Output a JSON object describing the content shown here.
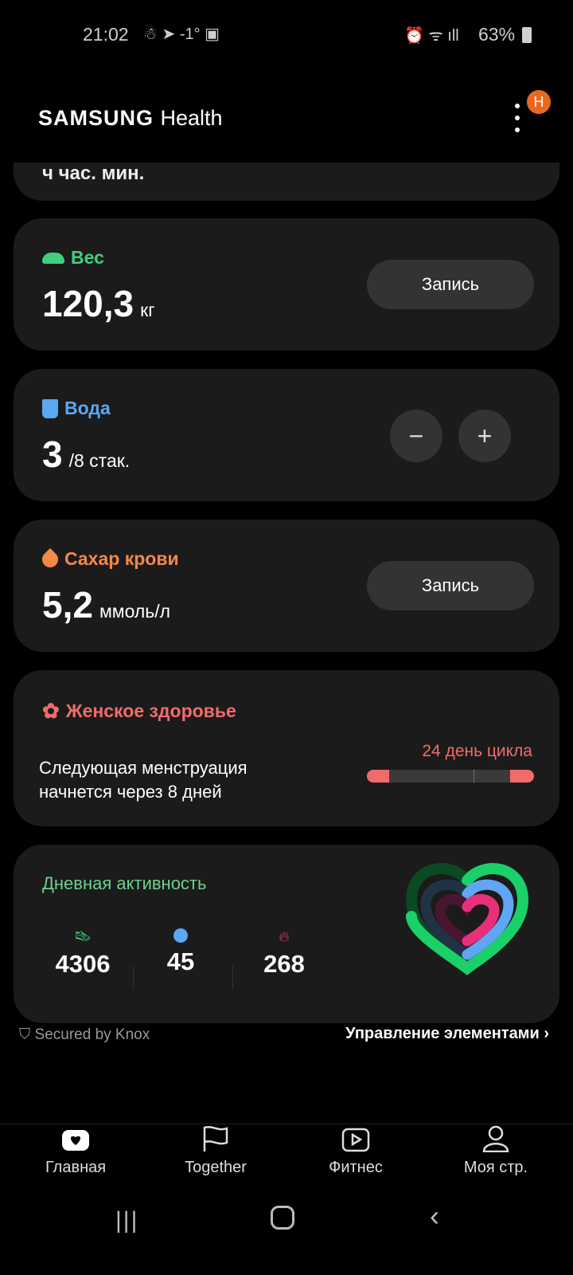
{
  "status_bar": {
    "time": "21:02",
    "temperature": "-1°",
    "battery": "63%"
  },
  "header": {
    "brand": "SAMSUNG",
    "app": "Health",
    "notification_badge": "H"
  },
  "sleep_card": {
    "partial_text": "ч час. мин."
  },
  "weight": {
    "title": "Вес",
    "value": "120,3",
    "unit": "кг",
    "button": "Запись",
    "color": "#3fcf7f"
  },
  "water": {
    "title": "Вода",
    "value": "3",
    "unit": "/8 стак.",
    "minus": "−",
    "plus": "+",
    "color": "#5aa8f2"
  },
  "sugar": {
    "title": "Сахар крови",
    "value": "5,2",
    "unit": "ммоль/л",
    "button": "Запись",
    "color": "#f3884a"
  },
  "women": {
    "title": "Женское здоровье",
    "line1": "Следующая менструация",
    "line2": "начнется через 8 дней",
    "cycle": "24 день цикла",
    "cycle_progress": 0.85,
    "color": "#f26b6b"
  },
  "activity": {
    "title": "Дневная активность",
    "color": "#6dd08d",
    "steps": "4306",
    "active_minutes": "45",
    "calories": "268"
  },
  "footer": {
    "knox": "Secured by Knox",
    "manage": "Управление элементами"
  },
  "nav": {
    "items": [
      {
        "label": "Главная"
      },
      {
        "label": "Together"
      },
      {
        "label": "Фитнес"
      },
      {
        "label": "Моя стр."
      }
    ]
  }
}
